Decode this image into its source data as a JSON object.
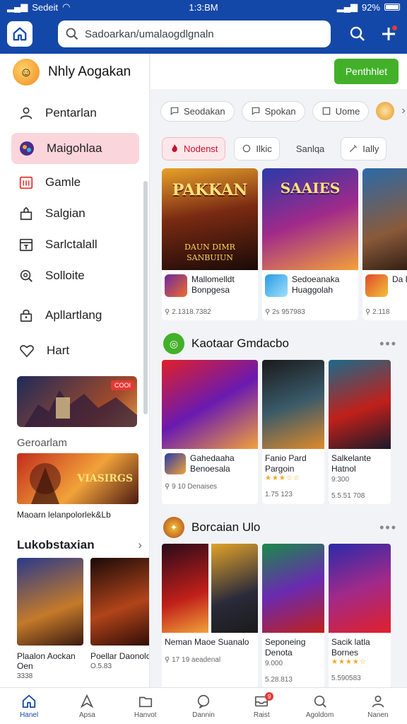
{
  "status_bar": {
    "carrier": "Sedeit",
    "time": "1:3:BM",
    "battery": "92%"
  },
  "header": {
    "search_value": "Sadoarkan/umalaogdlgnaln"
  },
  "sidebar": {
    "profile_name": "Nhly Aogakan",
    "items": [
      {
        "label": "Pentarlan",
        "icon": "user-icon"
      },
      {
        "label": "Maigohlaa",
        "icon": "game-controller-icon",
        "active": true
      },
      {
        "label": "Gamle",
        "icon": "calendar-icon"
      },
      {
        "label": "Salgian",
        "icon": "bag-icon"
      },
      {
        "label": "Sarlctalall",
        "icon": "schedule-icon"
      },
      {
        "label": "Solloite",
        "icon": "search-icon"
      },
      {
        "label": "Apllartlang",
        "icon": "lock-icon"
      },
      {
        "label": "Hart",
        "icon": "heart-icon"
      }
    ],
    "promo_tag": "COOI",
    "section_label": "Geroarlam",
    "banner_text": "VIASIRGS",
    "banner_caption": "Maoarn lelanpolorlek&Lb",
    "related_title": "Lukobstaxian",
    "related_cards": [
      {
        "title": "Plaalon Aockan Oen",
        "meta": "3338"
      },
      {
        "title": "Poellar Daonolos",
        "meta": "O.5.83"
      }
    ]
  },
  "main": {
    "action_button": "Penthhlet",
    "chips": [
      {
        "label": "Seodakan",
        "icon": "chat-icon"
      },
      {
        "label": "Spokan",
        "icon": "chat-icon"
      },
      {
        "label": "Uome",
        "icon": "window-icon"
      }
    ],
    "filters": [
      {
        "label": "Nodenst",
        "icon": "flame-icon",
        "active": true
      },
      {
        "label": "Ilkic",
        "icon": "tag-icon",
        "active": false
      },
      {
        "label": "Sanlqa",
        "icon": "",
        "active": false
      },
      {
        "label": "Ially",
        "icon": "wand-icon",
        "active": false
      }
    ],
    "featured": [
      {
        "name": "Mallomelldt Bonpgesa",
        "meta": "2.1318.7382",
        "art_title": "PAKKAN",
        "art_sub": "DAUN DIMR SANBUIUN"
      },
      {
        "name": "Sedoeanaka Huaggolah",
        "meta": "2s 957983",
        "art_title": "SAAIES"
      },
      {
        "name": "Da Da",
        "meta": "2.118"
      }
    ],
    "section1": {
      "title": "Kaotaar Gmdacbo",
      "cards": [
        {
          "name": "Gahedaaha Benoesala",
          "meta": "9 10 Denaises"
        },
        {
          "name": "Fanio Pard Pargoin",
          "meta": "1.75 123"
        },
        {
          "name": "Salkelante Hatnol",
          "meta": "5.5.51 708",
          "extra": "9:300"
        }
      ]
    },
    "section2": {
      "title": "Borcaian Ulo",
      "cards": [
        {
          "name": "Neman Maoe Suanalo",
          "meta": "17 19 aeadenal"
        },
        {
          "name": "Seponeing Denota",
          "meta": "5.28.813",
          "extra": "9.000"
        },
        {
          "name": "Sacik latla Bornes",
          "meta": "5.590583"
        }
      ]
    }
  },
  "bottom_nav": [
    {
      "label": "Hanel",
      "icon": "home-icon",
      "active": true
    },
    {
      "label": "Apsa",
      "icon": "navigate-icon"
    },
    {
      "label": "Hanvot",
      "icon": "folder-icon"
    },
    {
      "label": "Dannin",
      "icon": "chat-bubble-icon"
    },
    {
      "label": "Raist",
      "icon": "inbox-icon",
      "badge": "9"
    },
    {
      "label": "Agoldom",
      "icon": "search-icon"
    },
    {
      "label": "Nanen",
      "icon": "user-icon"
    }
  ],
  "colors": {
    "primary": "#1448a8",
    "accent_green": "#43b02a",
    "active_pink": "#fbd5dc",
    "red": "#e53935"
  }
}
